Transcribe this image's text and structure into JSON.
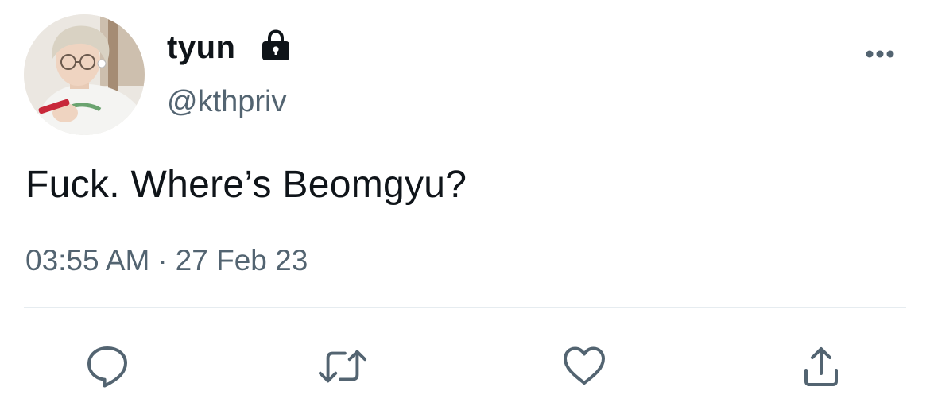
{
  "tweet": {
    "display_name": "tyun",
    "handle": "@kthpriv",
    "text": "Fuck. Where’s Beomgyu?",
    "time": "03:55 AM",
    "separator": "·",
    "date": "27 Feb 23",
    "protected_icon": "lock-icon",
    "more_icon": "more-horizontal-icon"
  },
  "actions": [
    {
      "name": "reply",
      "icon": "reply-icon"
    },
    {
      "name": "retweet",
      "icon": "retweet-icon"
    },
    {
      "name": "like",
      "icon": "heart-icon"
    },
    {
      "name": "share",
      "icon": "share-icon"
    }
  ],
  "colors": {
    "text_primary": "#0f1419",
    "text_secondary": "#536471",
    "divider": "#e6ecf0",
    "icon": "#536471"
  }
}
